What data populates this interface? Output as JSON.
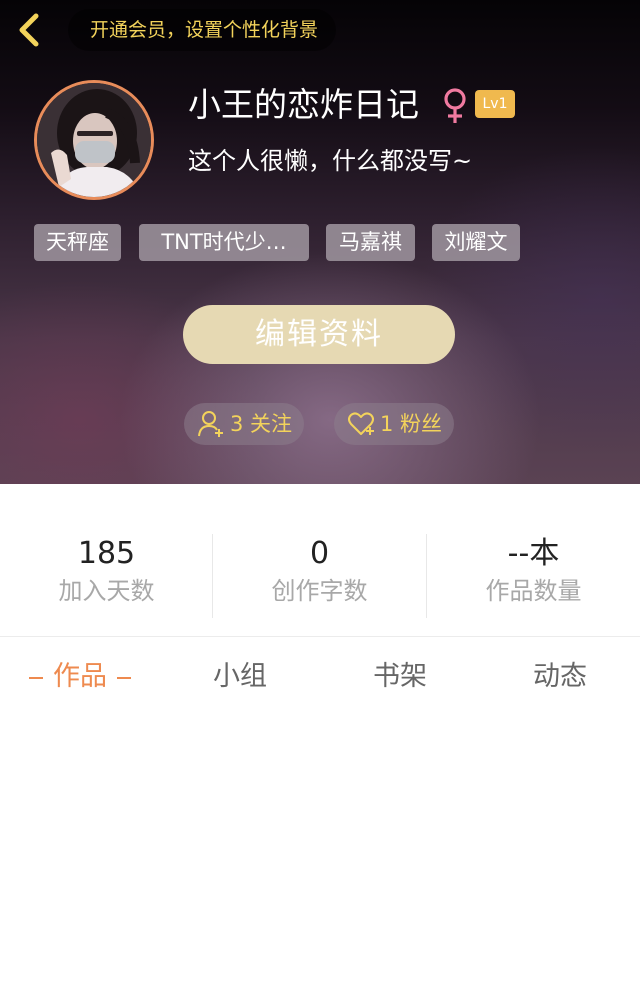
{
  "header": {
    "vip_banner": "开通会员，设置个性化背景"
  },
  "profile": {
    "username": "小王的恋炸日记",
    "level": "Lv1",
    "bio": "这个人很懒，什么都没写~",
    "tags": [
      "天秤座",
      "TNT时代少…",
      "马嘉祺",
      "刘耀文"
    ],
    "edit_label": "编辑资料",
    "following": "3 关注",
    "fans": "1 粉丝"
  },
  "stats": [
    {
      "value": "185",
      "label": "加入天数"
    },
    {
      "value": "0",
      "label": "创作字数"
    },
    {
      "value": "--本",
      "label": "作品数量"
    }
  ],
  "tabs": [
    {
      "label": "作品",
      "active": true
    },
    {
      "label": "小组",
      "active": false
    },
    {
      "label": "书架",
      "active": false
    },
    {
      "label": "动态",
      "active": false
    }
  ],
  "colors": {
    "accent": "#ee8a4f",
    "gold": "#f3d35b",
    "level_badge": "#f0b94e",
    "edit_button": "#e6d9b3",
    "gender_female": "#f07aa0"
  },
  "icons": {
    "back": "chevron-left-icon",
    "gender": "female-symbol-icon",
    "following": "add-user-icon",
    "fans": "heart-plus-icon"
  }
}
